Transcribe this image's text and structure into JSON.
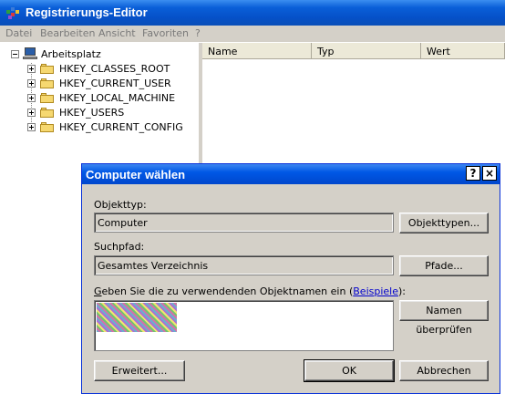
{
  "window": {
    "title": "Registrierungs-Editor"
  },
  "menu": [
    "Datei",
    "Bearbeiten",
    "Ansicht",
    "Favoriten",
    "?"
  ],
  "tree": {
    "root": "Arbeitsplatz",
    "keys": [
      "HKEY_CLASSES_ROOT",
      "HKEY_CURRENT_USER",
      "HKEY_LOCAL_MACHINE",
      "HKEY_USERS",
      "HKEY_CURRENT_CONFIG"
    ]
  },
  "list": {
    "columns": [
      "Name",
      "Typ",
      "Wert"
    ]
  },
  "dialog": {
    "title": "Computer wählen",
    "help_btn": "?",
    "close_btn": "×",
    "objecttype_label": "Objekttyp:",
    "objecttype_value": "Computer",
    "objecttype_button": "Objekttypen...",
    "path_label": "Suchpfad:",
    "path_value": "Gesamtes Verzeichnis",
    "path_button": "Pfade...",
    "names_label_first": "G",
    "names_label_rest": "eben Sie die zu verwendenden Objektnamen ein (",
    "names_label_link": "Beispiele",
    "names_label_end": "):",
    "check_button": "Namen überprüfen",
    "advanced_button": "Erweitert...",
    "ok_button": "OK",
    "cancel_button": "Abbrechen"
  },
  "colors": {
    "titlebar": "#0a5fd8",
    "link": "#0000cc"
  }
}
